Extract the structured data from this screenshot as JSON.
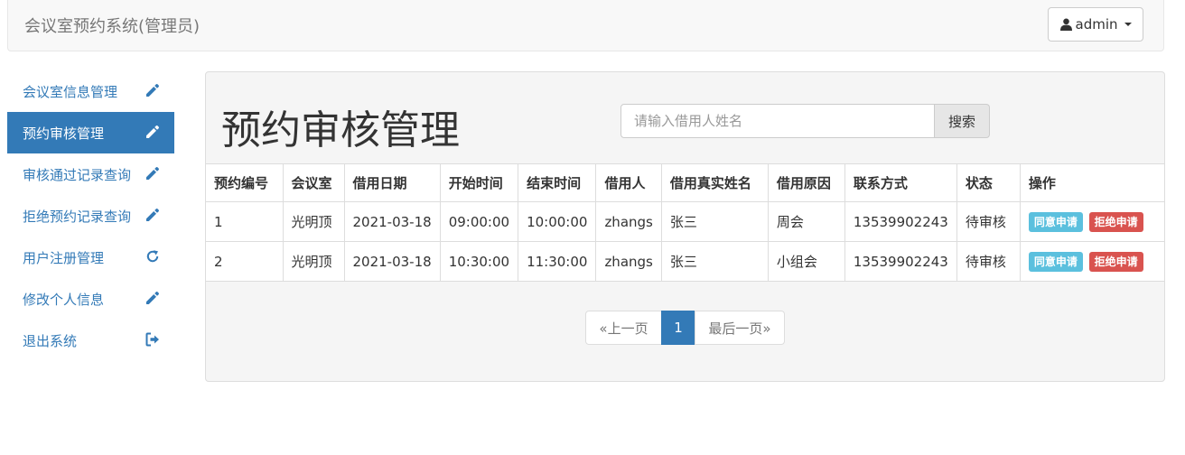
{
  "app": {
    "title": "会议室预约系统(管理员)"
  },
  "user": {
    "name": "admin"
  },
  "sidebar": {
    "items": [
      {
        "label": "会议室信息管理",
        "icon": "pencil-icon"
      },
      {
        "label": "预约审核管理",
        "icon": "pencil-icon",
        "active": true
      },
      {
        "label": "审核通过记录查询",
        "icon": "pencil-icon"
      },
      {
        "label": "拒绝预约记录查询",
        "icon": "pencil-icon"
      },
      {
        "label": "用户注册管理",
        "icon": "refresh-icon"
      },
      {
        "label": "修改个人信息",
        "icon": "pencil-icon"
      },
      {
        "label": "退出系统",
        "icon": "logout-icon"
      }
    ]
  },
  "main": {
    "title": "预约审核管理",
    "search": {
      "placeholder": "请输入借用人姓名",
      "button": "搜索"
    },
    "table": {
      "headers": [
        "预约编号",
        "会议室",
        "借用日期",
        "开始时间",
        "结束时间",
        "借用人",
        "借用真实姓名",
        "借用原因",
        "联系方式",
        "状态",
        "操作"
      ],
      "rows": [
        [
          "1",
          "光明顶",
          "2021-03-18",
          "09:00:00",
          "10:00:00",
          "zhangs",
          "张三",
          "周会",
          "13539902243",
          "待审核"
        ],
        [
          "2",
          "光明顶",
          "2021-03-18",
          "10:30:00",
          "11:30:00",
          "zhangs",
          "张三",
          "小组会",
          "13539902243",
          "待审核"
        ]
      ],
      "approve_label": "同意申请",
      "reject_label": "拒绝申请"
    },
    "pagination": {
      "prev": "«上一页",
      "current": "1",
      "last": "最后一页»"
    }
  },
  "colors": {
    "primary": "#337ab7",
    "info": "#5bc0de",
    "danger": "#d9534f"
  }
}
